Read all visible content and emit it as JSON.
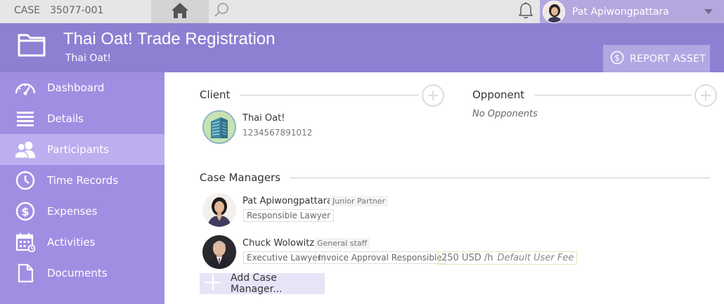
{
  "topbar": {
    "case_label": "CASE",
    "case_number": "35077-001",
    "user_name": "Pat Apiwongpattara"
  },
  "header": {
    "title": "Thai Oat! Trade Registration",
    "subtitle": "Thai Oat!",
    "report_button": "REPORT ASSET"
  },
  "sidebar": {
    "items": [
      {
        "label": "Dashboard",
        "icon": "gauge-icon"
      },
      {
        "label": "Details",
        "icon": "list-icon"
      },
      {
        "label": "Participants",
        "icon": "people-icon",
        "active": true
      },
      {
        "label": "Time Records",
        "icon": "clock-icon"
      },
      {
        "label": "Expenses",
        "icon": "dollar-icon"
      },
      {
        "label": "Activities",
        "icon": "calendar-icon"
      },
      {
        "label": "Documents",
        "icon": "document-icon"
      }
    ]
  },
  "client": {
    "section_title": "Client",
    "name": "Thai Oat!",
    "id": "1234567891012"
  },
  "opponent": {
    "section_title": "Opponent",
    "empty_text": "No Opponents"
  },
  "case_managers": {
    "section_title": "Case Managers",
    "people": [
      {
        "name": "Pat Apiwongpattara",
        "role": "Junior Partner",
        "tags": [
          "Responsible Lawyer"
        ]
      },
      {
        "name": "Chuck Wolowitz",
        "role": "General staff",
        "tags": [
          "Executive Lawyer",
          "Invoice Approval Responsible"
        ],
        "fee": "250 USD /h",
        "fee_note": "Default User Fee"
      }
    ],
    "add_button": "Add Case Manager..."
  },
  "colors": {
    "header": "#8e7fd3",
    "sidebar": "#a08ee3",
    "sidebar_active": "#bdaef0"
  }
}
